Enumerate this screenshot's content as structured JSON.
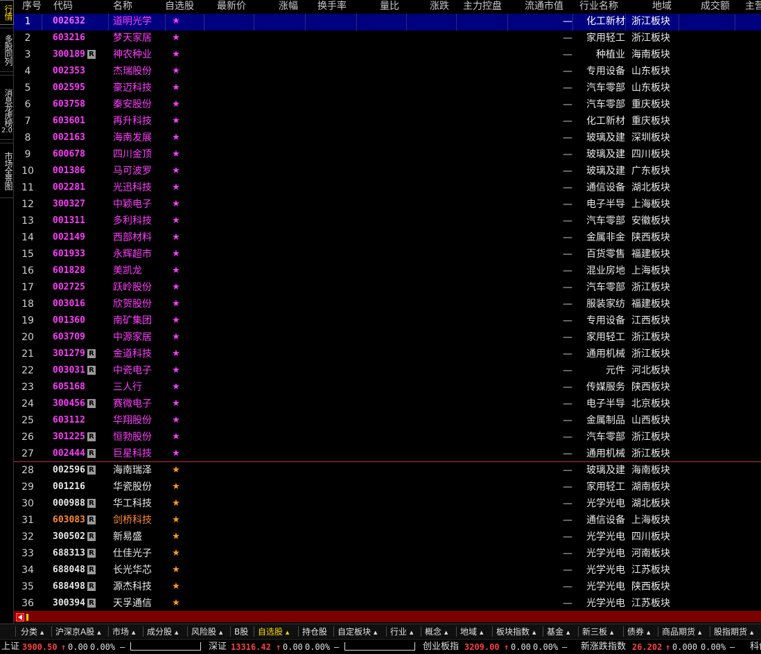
{
  "left_tabs": [
    {
      "label": "行情",
      "active": true
    },
    {
      "label": "多股同列",
      "active": false
    },
    {
      "label": "消息龙虎榜",
      "sub": "2.0",
      "active": false
    },
    {
      "label": "市场全景图",
      "active": false
    }
  ],
  "header": {
    "cols": [
      "序号",
      "代码",
      "名称",
      "自选股",
      "最新价",
      "涨幅",
      "换手率",
      "量比",
      "涨跌",
      "主力控盘",
      "流通市值",
      "行业名称",
      "地域",
      "成交额",
      "主营"
    ]
  },
  "rows": [
    {
      "idx": "1",
      "code": "002632",
      "r": false,
      "name": "道明光学",
      "dash": "—",
      "industry": "化工新材",
      "region": "浙江板块",
      "style": "mag",
      "selected": true
    },
    {
      "idx": "2",
      "code": "603216",
      "r": false,
      "name": "梦天家居",
      "dash": "—",
      "industry": "家用轻工",
      "region": "浙江板块",
      "style": "mag"
    },
    {
      "idx": "3",
      "code": "300189",
      "r": true,
      "name": "神农种业",
      "dash": "—",
      "industry": "种植业",
      "region": "海南板块",
      "style": "mag"
    },
    {
      "idx": "4",
      "code": "002353",
      "r": false,
      "name": "杰瑞股份",
      "dash": "—",
      "industry": "专用设备",
      "region": "山东板块",
      "style": "mag"
    },
    {
      "idx": "5",
      "code": "002595",
      "r": false,
      "name": "豪迈科技",
      "dash": "—",
      "industry": "汽车零部",
      "region": "山东板块",
      "style": "mag"
    },
    {
      "idx": "6",
      "code": "603758",
      "r": false,
      "name": "秦安股份",
      "dash": "—",
      "industry": "汽车零部",
      "region": "重庆板块",
      "style": "mag"
    },
    {
      "idx": "7",
      "code": "603601",
      "r": false,
      "name": "再升科技",
      "dash": "—",
      "industry": "化工新材",
      "region": "重庆板块",
      "style": "mag"
    },
    {
      "idx": "8",
      "code": "002163",
      "r": false,
      "name": "海南发展",
      "dash": "—",
      "industry": "玻璃及建",
      "region": "深圳板块",
      "style": "mag"
    },
    {
      "idx": "9",
      "code": "600678",
      "r": false,
      "name": "四川金顶",
      "dash": "—",
      "industry": "玻璃及建",
      "region": "四川板块",
      "style": "mag"
    },
    {
      "idx": "10",
      "code": "001386",
      "r": false,
      "name": "马可波罗",
      "dash": "—",
      "industry": "玻璃及建",
      "region": "广东板块",
      "style": "mag"
    },
    {
      "idx": "11",
      "code": "002281",
      "r": false,
      "name": "光迅科技",
      "dash": "—",
      "industry": "通信设备",
      "region": "湖北板块",
      "style": "mag"
    },
    {
      "idx": "12",
      "code": "300327",
      "r": false,
      "name": "中颖电子",
      "dash": "—",
      "industry": "电子半导",
      "region": "上海板块",
      "style": "mag"
    },
    {
      "idx": "13",
      "code": "001311",
      "r": false,
      "name": "多利科技",
      "dash": "—",
      "industry": "汽车零部",
      "region": "安徽板块",
      "style": "mag"
    },
    {
      "idx": "14",
      "code": "002149",
      "r": false,
      "name": "西部材料",
      "dash": "—",
      "industry": "金属非金",
      "region": "陕西板块",
      "style": "mag"
    },
    {
      "idx": "15",
      "code": "601933",
      "r": false,
      "name": "永辉超市",
      "dash": "—",
      "industry": "百货零售",
      "region": "福建板块",
      "style": "mag"
    },
    {
      "idx": "16",
      "code": "601828",
      "r": false,
      "name": "美凯龙",
      "dash": "—",
      "industry": "混业房地",
      "region": "上海板块",
      "style": "mag"
    },
    {
      "idx": "17",
      "code": "002725",
      "r": false,
      "name": "跃岭股份",
      "dash": "—",
      "industry": "汽车零部",
      "region": "浙江板块",
      "style": "mag"
    },
    {
      "idx": "18",
      "code": "003016",
      "r": false,
      "name": "欣贺股份",
      "dash": "—",
      "industry": "服装家纺",
      "region": "福建板块",
      "style": "mag"
    },
    {
      "idx": "19",
      "code": "001360",
      "r": false,
      "name": "南矿集团",
      "dash": "—",
      "industry": "专用设备",
      "region": "江西板块",
      "style": "mag"
    },
    {
      "idx": "20",
      "code": "603709",
      "r": false,
      "name": "中源家居",
      "dash": "—",
      "industry": "家用轻工",
      "region": "浙江板块",
      "style": "mag"
    },
    {
      "idx": "21",
      "code": "301279",
      "r": true,
      "name": "金道科技",
      "dash": "—",
      "industry": "通用机械",
      "region": "浙江板块",
      "style": "mag"
    },
    {
      "idx": "22",
      "code": "003031",
      "r": true,
      "name": "中瓷电子",
      "dash": "—",
      "industry": "元件",
      "region": "河北板块",
      "style": "mag"
    },
    {
      "idx": "23",
      "code": "605168",
      "r": false,
      "name": "三人行",
      "dash": "—",
      "industry": "传媒服务",
      "region": "陕西板块",
      "style": "mag"
    },
    {
      "idx": "24",
      "code": "300456",
      "r": true,
      "name": "赛微电子",
      "dash": "—",
      "industry": "电子半导",
      "region": "北京板块",
      "style": "mag"
    },
    {
      "idx": "25",
      "code": "603112",
      "r": false,
      "name": "华翔股份",
      "dash": "—",
      "industry": "金属制品",
      "region": "山西板块",
      "style": "mag"
    },
    {
      "idx": "26",
      "code": "301225",
      "r": true,
      "name": "恒勃股份",
      "dash": "—",
      "industry": "汽车零部",
      "region": "浙江板块",
      "style": "mag"
    },
    {
      "idx": "27",
      "code": "002444",
      "r": true,
      "name": "巨星科技",
      "dash": "—",
      "industry": "通用机械",
      "region": "浙江板块",
      "style": "mag"
    },
    {
      "idx": "28",
      "code": "002596",
      "r": true,
      "name": "海南瑞泽",
      "dash": "—",
      "industry": "玻璃及建",
      "region": "海南板块",
      "style": "white"
    },
    {
      "idx": "29",
      "code": "001216",
      "r": false,
      "name": "华瓷股份",
      "dash": "—",
      "industry": "家用轻工",
      "region": "湖南板块",
      "style": "white"
    },
    {
      "idx": "30",
      "code": "000988",
      "r": true,
      "name": "华工科技",
      "dash": "—",
      "industry": "光学光电",
      "region": "湖北板块",
      "style": "white"
    },
    {
      "idx": "31",
      "code": "603083",
      "r": true,
      "name": "剑桥科技",
      "dash": "—",
      "industry": "通信设备",
      "region": "上海板块",
      "style": "orange"
    },
    {
      "idx": "32",
      "code": "300502",
      "r": true,
      "name": "新易盛",
      "dash": "—",
      "industry": "光学光电",
      "region": "四川板块",
      "style": "white"
    },
    {
      "idx": "33",
      "code": "688313",
      "r": true,
      "name": "仕佳光子",
      "dash": "—",
      "industry": "光学光电",
      "region": "河南板块",
      "style": "white"
    },
    {
      "idx": "34",
      "code": "688048",
      "r": true,
      "name": "长光华芯",
      "dash": "—",
      "industry": "光学光电",
      "region": "江苏板块",
      "style": "white"
    },
    {
      "idx": "35",
      "code": "688498",
      "r": true,
      "name": "源杰科技",
      "dash": "—",
      "industry": "光学光电",
      "region": "陕西板块",
      "style": "white"
    },
    {
      "idx": "36",
      "code": "300394",
      "r": true,
      "name": "天孚通信",
      "dash": "—",
      "industry": "光学光电",
      "region": "江苏板块",
      "style": "white"
    }
  ],
  "r_badge": "R",
  "star_glyph": "★",
  "bottom_tabs": [
    {
      "label": "分类",
      "tri": true
    },
    {
      "label": "沪深京A股",
      "tri": true
    },
    {
      "label": "市场",
      "tri": true
    },
    {
      "label": "成分股",
      "tri": true
    },
    {
      "label": "风险股",
      "tri": true
    },
    {
      "label": "B股",
      "tri": false
    },
    {
      "label": "自选股",
      "tri": true,
      "active": true
    },
    {
      "label": "持仓股",
      "tri": false
    },
    {
      "label": "自定板块",
      "tri": true
    },
    {
      "label": "行业",
      "tri": true
    },
    {
      "label": "概念",
      "tri": true
    },
    {
      "label": "地域",
      "tri": true
    },
    {
      "label": "板块指数",
      "tri": true
    },
    {
      "label": "基金",
      "tri": true
    },
    {
      "label": "新三板",
      "tri": true
    },
    {
      "label": "债券",
      "tri": true
    },
    {
      "label": "商品期货",
      "tri": true
    },
    {
      "label": "股指期货",
      "tri": true
    }
  ],
  "status": {
    "sh_label": "上证",
    "sh_value": "3900.50",
    "sh_change": "0.00",
    "sh_pct": "0.00%",
    "sz_label": "深证",
    "sz_value": "13316.42",
    "sz_change": "0.00",
    "sz_pct": "0.00%",
    "cy_label": "创业板指",
    "cy_value": "3209.00",
    "cy_change": "0.00",
    "cy_pct": "0.00%",
    "xz_label": "新涨跌指数",
    "xz_value": "26.202",
    "xz_change": "0.000",
    "xz_pct": "0.00%",
    "kc_label": "科创",
    "up_arrow": "↑",
    "dash": "—"
  },
  "colors": {
    "magenta": "#ff3cff",
    "orange": "#ff8a30",
    "selected_bg": "#00007e",
    "divider": "#c03030"
  }
}
